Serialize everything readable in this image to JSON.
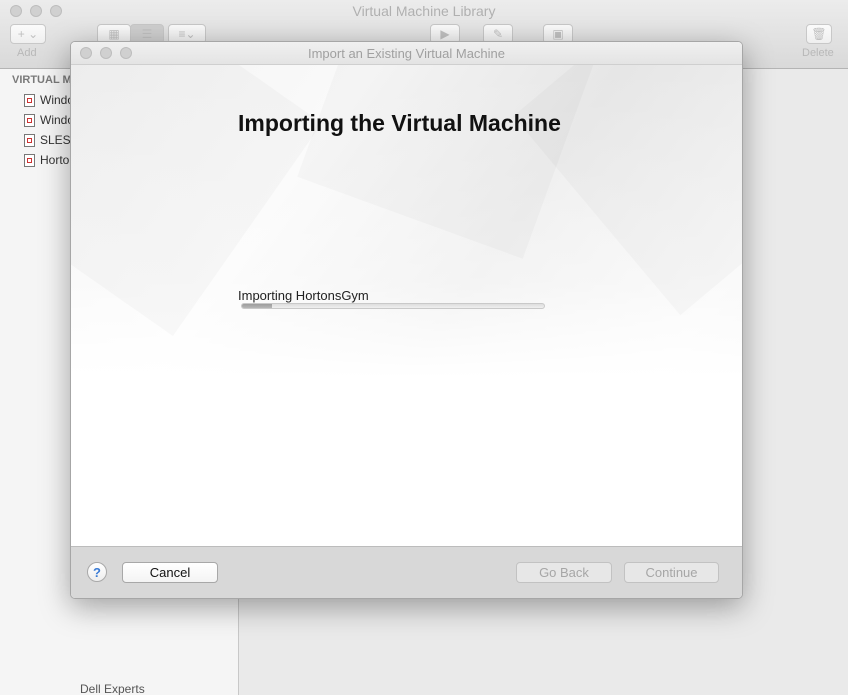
{
  "library": {
    "title": "Virtual Machine Library",
    "add_label": "Add",
    "delete_label": "Delete",
    "sidebar_heading": "VIRTUAL M",
    "vms": [
      "Windo",
      "Windo",
      "SLES",
      "Horto"
    ],
    "bottom_fragment": "Dell Experts"
  },
  "modal": {
    "title": "Import an Existing Virtual Machine",
    "heading": "Importing the Virtual Machine",
    "status": "Importing HortonsGym",
    "progress": 0.1,
    "help_label": "?",
    "cancel_label": "Cancel",
    "back_label": "Go Back",
    "continue_label": "Continue"
  }
}
